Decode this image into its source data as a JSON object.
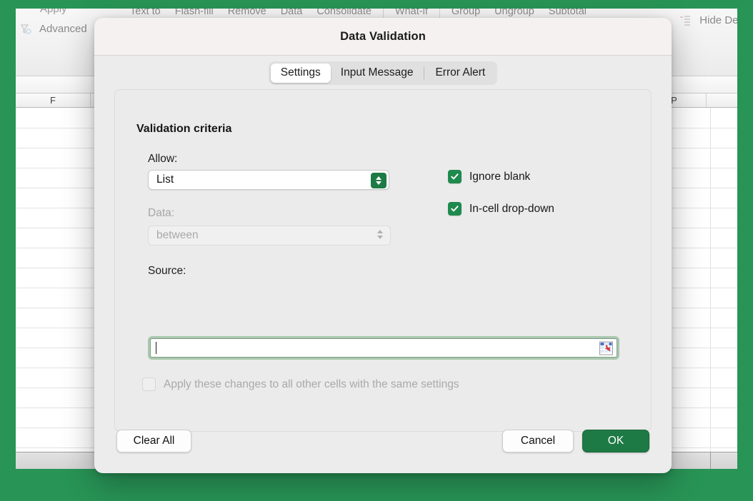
{
  "background": {
    "ribbon_items_row1": [
      "Text to",
      "Flash-fill",
      "Remove",
      "Data",
      "Consolidate",
      "What-if",
      "Group",
      "Ungroup",
      "Subtotal"
    ],
    "apply_label": "Apply",
    "advanced_label": "Advanced",
    "hide_detail_label": "Hide Deta",
    "column_headers": [
      "F",
      "P"
    ],
    "frame_color": "#289456"
  },
  "dialog": {
    "title": "Data Validation",
    "tabs": [
      {
        "label": "Settings",
        "active": true
      },
      {
        "label": "Input Message",
        "active": false
      },
      {
        "label": "Error Alert",
        "active": false
      }
    ],
    "section_title": "Validation criteria",
    "allow": {
      "label": "Allow:",
      "value": "List",
      "enabled": true
    },
    "data": {
      "label": "Data:",
      "value": "between",
      "enabled": false
    },
    "source": {
      "label": "Source:",
      "value": "",
      "focused": true,
      "picker_icon": "range-picker-icon"
    },
    "options": [
      {
        "label": "Ignore blank",
        "checked": true,
        "enabled": true
      },
      {
        "label": "In-cell drop-down",
        "checked": true,
        "enabled": true
      }
    ],
    "apply_all": {
      "label": "Apply these changes to all other cells with the same settings",
      "checked": false,
      "enabled": false
    },
    "buttons": {
      "clear_all": "Clear All",
      "cancel": "Cancel",
      "ok": "OK"
    },
    "colors": {
      "accent_green": "#1e7a45",
      "checkbox_green": "#1e8a4d",
      "focus_ring": "#a9c8ae"
    }
  }
}
